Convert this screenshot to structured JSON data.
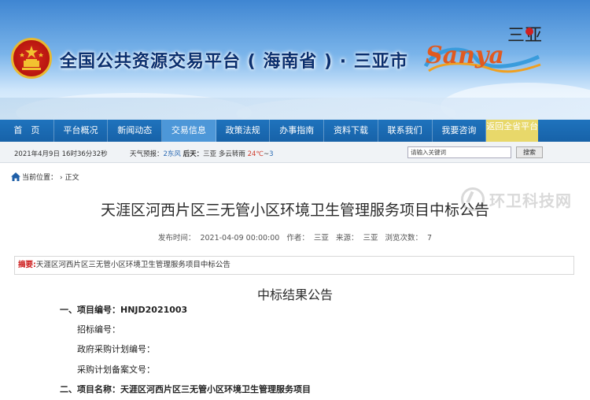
{
  "banner": {
    "site_title": "全国公共资源交易平台 ( 海南省 ) · 三亚市",
    "logo_text": "Sanya",
    "logo_chinese": "三亚"
  },
  "nav": {
    "items": [
      {
        "label": "首　页",
        "active": false
      },
      {
        "label": "平台概况",
        "active": false
      },
      {
        "label": "新闻动态",
        "active": false
      },
      {
        "label": "交易信息",
        "active": true
      },
      {
        "label": "政策法规",
        "active": false
      },
      {
        "label": "办事指南",
        "active": false
      },
      {
        "label": "资料下载",
        "active": false
      },
      {
        "label": "联系我们",
        "active": false
      },
      {
        "label": "我要咨询",
        "active": false
      }
    ],
    "special_label": "返回全省平台"
  },
  "info_bar": {
    "datetime": "2021年4月9日 16时36分32秒",
    "weather_label": "天气预报：",
    "wind_prefix": "2东风",
    "day_label": "后天：",
    "city": "三亚",
    "condition": "多云转雨",
    "temp_high": "24℃",
    "temp_sep": "~",
    "temp_low": "3",
    "search_placeholder": "请输入关键词",
    "search_button": "搜索"
  },
  "breadcrumb": {
    "label": "当前位置：",
    "current": "正文"
  },
  "article": {
    "title": "天涯区河西片区三无管小区环境卫生管理服务项目中标公告",
    "publish_label": "发布时间：",
    "publish_time": "2021-04-09 00:00:00",
    "author_label": "作者：",
    "author": "三亚",
    "source_label": "来源：",
    "source": "三亚",
    "views_label": "浏览次数：",
    "views": "7",
    "abstract_label": "摘要:",
    "abstract_text": "天涯区河西片区三无管小区环境卫生管理服务项目中标公告",
    "section_title": "中标结果公告",
    "lines": [
      "一、项目编号：HNJD2021003",
      "招标编号：",
      "政府采购计划编号：",
      "采购计划备案文号：",
      "二、项目名称：天涯区河西片区三无管小区环境卫生管理服务项目"
    ]
  },
  "watermark": {
    "text": "环卫科技网"
  },
  "colors": {
    "nav_blue": "#1762a8",
    "nav_active": "#4d97d8",
    "special_tab": "#e8d86a",
    "abstract_label": "#cc1b1b",
    "title_blue": "#0b2f6e"
  }
}
